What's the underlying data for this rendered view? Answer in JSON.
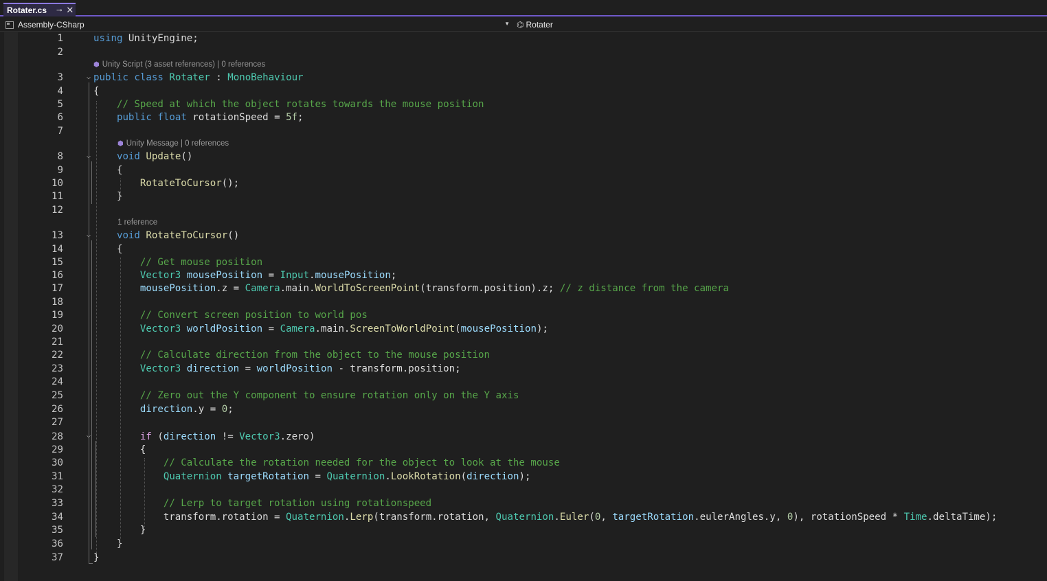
{
  "tab": {
    "filename": "Rotater.cs",
    "pin": "⊸",
    "close": "✕"
  },
  "nav": {
    "project": "Assembly-CSharp",
    "member": "Rotater"
  },
  "code_lens": {
    "class": "Unity Script (3 asset references) | 0 references",
    "update": "Unity Message | 0 references",
    "rotate": "1 reference"
  },
  "lines": [
    {
      "n": "1",
      "segs": [
        [
          "kw",
          "using"
        ],
        [
          "pl",
          " UnityEngine;"
        ]
      ]
    },
    {
      "n": "2",
      "segs": []
    },
    {
      "n": "3",
      "segs": [
        [
          "kw",
          "public"
        ],
        [
          "pl",
          " "
        ],
        [
          "kw",
          "class"
        ],
        [
          "pl",
          " "
        ],
        [
          "ty",
          "Rotater"
        ],
        [
          "pl",
          " : "
        ],
        [
          "ty",
          "MonoBehaviour"
        ]
      ]
    },
    {
      "n": "4",
      "segs": [
        [
          "pl",
          "{"
        ]
      ]
    },
    {
      "n": "5",
      "segs": [
        [
          "pl",
          "    "
        ],
        [
          "cm",
          "// Speed at which the object rotates towards the mouse position"
        ]
      ]
    },
    {
      "n": "6",
      "segs": [
        [
          "pl",
          "    "
        ],
        [
          "kw",
          "public"
        ],
        [
          "pl",
          " "
        ],
        [
          "kw",
          "float"
        ],
        [
          "pl",
          " rotationSpeed = "
        ],
        [
          "nm",
          "5f"
        ],
        [
          "pl",
          ";"
        ]
      ]
    },
    {
      "n": "7",
      "segs": []
    },
    {
      "n": "8",
      "segs": [
        [
          "pl",
          "    "
        ],
        [
          "kw",
          "void"
        ],
        [
          "pl",
          " "
        ],
        [
          "fn",
          "Update"
        ],
        [
          "pl",
          "()"
        ]
      ]
    },
    {
      "n": "9",
      "segs": [
        [
          "pl",
          "    {"
        ]
      ]
    },
    {
      "n": "10",
      "segs": [
        [
          "pl",
          "        "
        ],
        [
          "fn",
          "RotateToCursor"
        ],
        [
          "pl",
          "();"
        ]
      ]
    },
    {
      "n": "11",
      "segs": [
        [
          "pl",
          "    }"
        ]
      ]
    },
    {
      "n": "12",
      "segs": []
    },
    {
      "n": "13",
      "segs": [
        [
          "pl",
          "    "
        ],
        [
          "kw",
          "void"
        ],
        [
          "pl",
          " "
        ],
        [
          "fn",
          "RotateToCursor"
        ],
        [
          "pl",
          "()"
        ]
      ]
    },
    {
      "n": "14",
      "segs": [
        [
          "pl",
          "    {"
        ]
      ]
    },
    {
      "n": "15",
      "segs": [
        [
          "pl",
          "        "
        ],
        [
          "cm",
          "// Get mouse position"
        ]
      ]
    },
    {
      "n": "16",
      "segs": [
        [
          "pl",
          "        "
        ],
        [
          "ty",
          "Vector3"
        ],
        [
          "pl",
          " "
        ],
        [
          "var",
          "mousePosition"
        ],
        [
          "pl",
          " = "
        ],
        [
          "ty",
          "Input"
        ],
        [
          "pl",
          "."
        ],
        [
          "var",
          "mousePosition"
        ],
        [
          "pl",
          ";"
        ]
      ]
    },
    {
      "n": "17",
      "segs": [
        [
          "pl",
          "        "
        ],
        [
          "var",
          "mousePosition"
        ],
        [
          "pl",
          ".z = "
        ],
        [
          "ty",
          "Camera"
        ],
        [
          "pl",
          ".main."
        ],
        [
          "fn",
          "WorldToScreenPoint"
        ],
        [
          "pl",
          "(transform.position).z; "
        ],
        [
          "cm",
          "// z distance from the camera"
        ]
      ]
    },
    {
      "n": "18",
      "segs": []
    },
    {
      "n": "19",
      "segs": [
        [
          "pl",
          "        "
        ],
        [
          "cm",
          "// Convert screen position to world pos"
        ]
      ]
    },
    {
      "n": "20",
      "segs": [
        [
          "pl",
          "        "
        ],
        [
          "ty",
          "Vector3"
        ],
        [
          "pl",
          " "
        ],
        [
          "var",
          "worldPosition"
        ],
        [
          "pl",
          " = "
        ],
        [
          "ty",
          "Camera"
        ],
        [
          "pl",
          ".main."
        ],
        [
          "fn",
          "ScreenToWorldPoint"
        ],
        [
          "pl",
          "("
        ],
        [
          "var",
          "mousePosition"
        ],
        [
          "pl",
          ");"
        ]
      ]
    },
    {
      "n": "21",
      "segs": []
    },
    {
      "n": "22",
      "segs": [
        [
          "pl",
          "        "
        ],
        [
          "cm",
          "// Calculate direction from the object to the mouse position"
        ]
      ]
    },
    {
      "n": "23",
      "segs": [
        [
          "pl",
          "        "
        ],
        [
          "ty",
          "Vector3"
        ],
        [
          "pl",
          " "
        ],
        [
          "var",
          "direction"
        ],
        [
          "pl",
          " = "
        ],
        [
          "var",
          "worldPosition"
        ],
        [
          "pl",
          " - transform.position;"
        ]
      ]
    },
    {
      "n": "24",
      "segs": []
    },
    {
      "n": "25",
      "segs": [
        [
          "pl",
          "        "
        ],
        [
          "cm",
          "// Zero out the Y component to ensure rotation only on the Y axis"
        ]
      ]
    },
    {
      "n": "26",
      "segs": [
        [
          "pl",
          "        "
        ],
        [
          "var",
          "direction"
        ],
        [
          "pl",
          ".y = "
        ],
        [
          "nm",
          "0"
        ],
        [
          "pl",
          ";"
        ]
      ]
    },
    {
      "n": "27",
      "segs": []
    },
    {
      "n": "28",
      "segs": [
        [
          "pl",
          "        "
        ],
        [
          "ctl",
          "if"
        ],
        [
          "pl",
          " ("
        ],
        [
          "var",
          "direction"
        ],
        [
          "pl",
          " != "
        ],
        [
          "ty",
          "Vector3"
        ],
        [
          "pl",
          ".zero)"
        ]
      ]
    },
    {
      "n": "29",
      "segs": [
        [
          "pl",
          "        {"
        ]
      ]
    },
    {
      "n": "30",
      "segs": [
        [
          "pl",
          "            "
        ],
        [
          "cm",
          "// Calculate the rotation needed for the object to look at the mouse"
        ]
      ]
    },
    {
      "n": "31",
      "segs": [
        [
          "pl",
          "            "
        ],
        [
          "ty",
          "Quaternion"
        ],
        [
          "pl",
          " "
        ],
        [
          "var",
          "targetRotation"
        ],
        [
          "pl",
          " = "
        ],
        [
          "ty",
          "Quaternion"
        ],
        [
          "pl",
          "."
        ],
        [
          "fn",
          "LookRotation"
        ],
        [
          "pl",
          "("
        ],
        [
          "var",
          "direction"
        ],
        [
          "pl",
          ");"
        ]
      ]
    },
    {
      "n": "32",
      "segs": []
    },
    {
      "n": "33",
      "segs": [
        [
          "pl",
          "            "
        ],
        [
          "cm",
          "// Lerp to target rotation using rotationspeed"
        ]
      ]
    },
    {
      "n": "34",
      "segs": [
        [
          "pl",
          "            transform.rotation = "
        ],
        [
          "ty",
          "Quaternion"
        ],
        [
          "pl",
          "."
        ],
        [
          "fn",
          "Lerp"
        ],
        [
          "pl",
          "(transform.rotation, "
        ],
        [
          "ty",
          "Quaternion"
        ],
        [
          "pl",
          "."
        ],
        [
          "fn",
          "Euler"
        ],
        [
          "pl",
          "("
        ],
        [
          "nm",
          "0"
        ],
        [
          "pl",
          ", "
        ],
        [
          "var",
          "targetRotation"
        ],
        [
          "pl",
          ".eulerAngles.y, "
        ],
        [
          "nm",
          "0"
        ],
        [
          "pl",
          "), rotationSpeed * "
        ],
        [
          "ty",
          "Time"
        ],
        [
          "pl",
          ".deltaTime);"
        ]
      ]
    },
    {
      "n": "35",
      "segs": [
        [
          "pl",
          "        }"
        ]
      ]
    },
    {
      "n": "36",
      "segs": [
        [
          "pl",
          "    }"
        ]
      ]
    },
    {
      "n": "37",
      "segs": [
        [
          "pl",
          "}"
        ]
      ]
    }
  ]
}
